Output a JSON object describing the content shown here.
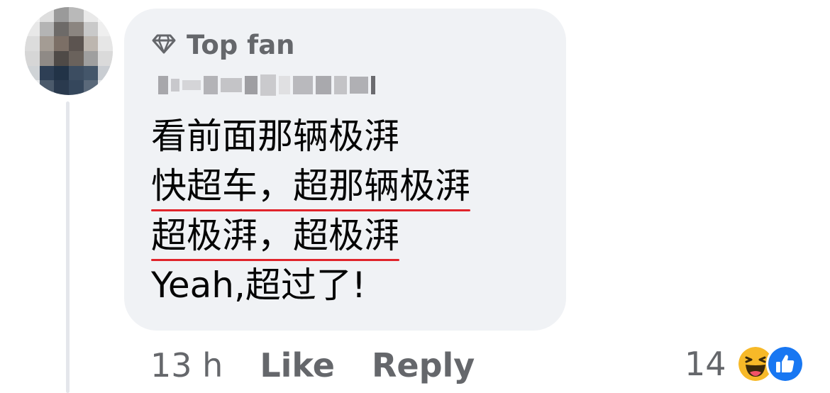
{
  "comment": {
    "badge_label": "Top fan",
    "badge_icon": "diamond-icon",
    "author_name": "*** ****** ****",
    "lines": [
      "看前面那辆极湃",
      "快超车，超那辆极湃",
      "超极湃，超极湃",
      "Yeah,超过了!"
    ]
  },
  "actions": {
    "time": "13 h",
    "like_label": "Like",
    "reply_label": "Reply"
  },
  "reactions": {
    "count": "14",
    "icons": [
      "haha-reaction-icon",
      "like-reaction-icon"
    ]
  },
  "colors": {
    "bubble": "#f0f2f5",
    "secondary_text": "#65676b",
    "underline": "#e0242b",
    "like_blue": "#1877f2",
    "haha_yellow": "#f7b928"
  }
}
